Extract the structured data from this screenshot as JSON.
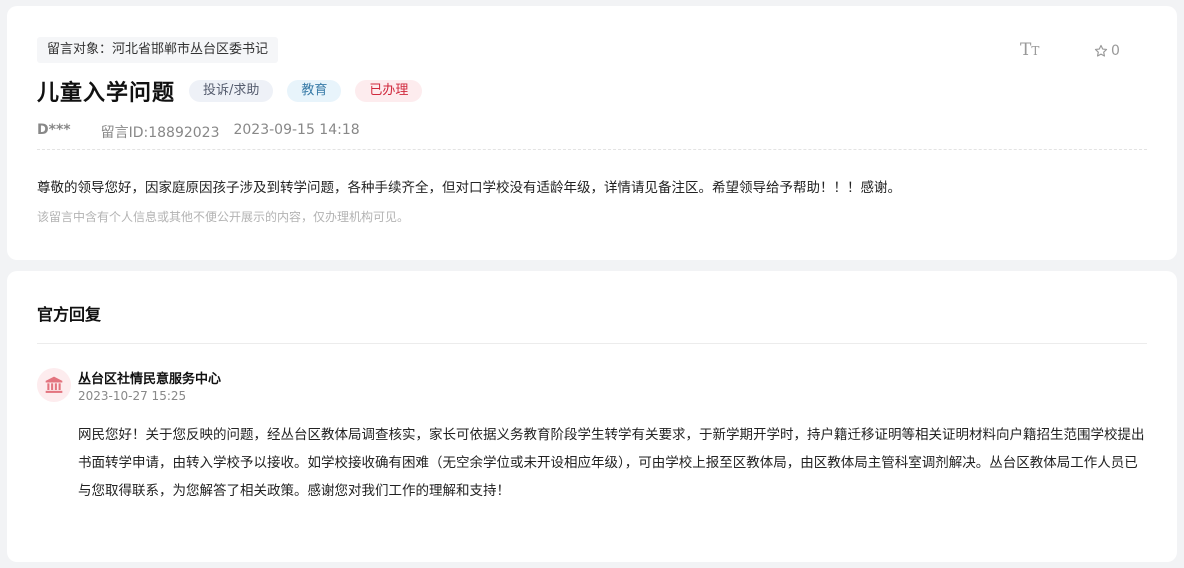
{
  "message": {
    "target": "留言对象：河北省邯郸市丛台区委书记",
    "title": "儿童入学问题",
    "tags": {
      "type": "投诉/求助",
      "domain": "教育",
      "status": "已办理"
    },
    "author": "D***",
    "id": "留言ID:18892023",
    "time": "2023-09-15 14:18",
    "font_toggle_icon": "text-size-icon",
    "favorite_count": "0",
    "content": "尊敬的领导您好，因家庭原因孩子涉及到转学问题，各种手续齐全，但对口学校没有适龄年级，详情请见备注区。希望领导给予帮助！！！感谢。",
    "privacy_note": "该留言中含有个人信息或其他不便公开展示的内容，仅办理机构可见。"
  },
  "reply": {
    "section_title": "官方回复",
    "org": "丛台区社情民意服务中心",
    "time": "2023-10-27 15:25",
    "icon": "government-building-icon",
    "body": "网民您好！关于您反映的问题，经丛台区教体局调查核实，家长可依据义务教育阶段学生转学有关要求，于新学期开学时，持户籍迁移证明等相关证明材料向户籍招生范围学校提出书面转学申请，由转入学校予以接收。如学校接收确有困难（无空余学位或未开设相应年级），可由学校上报至区教体局，由区教体局主管科室调剂解决。丛台区教体局工作人员已与您取得联系，为您解答了相关政策。感谢您对我们工作的理解和支持！"
  },
  "colors": {
    "status_red": "#d0283c",
    "domain_blue": "#3a7ca8",
    "page_bg": "#f2f3f5"
  }
}
